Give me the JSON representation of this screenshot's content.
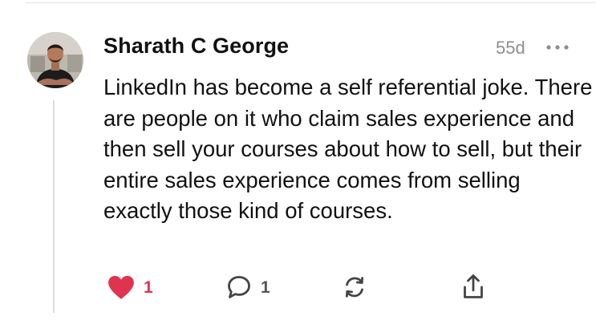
{
  "comment": {
    "author": "Sharath C George",
    "timestamp": "55d",
    "text": "LinkedIn has become a self referential joke. There are people on it who claim sales experience and then sell your courses about how to sell, but their entire sales experience comes from selling exactly those kind of courses.",
    "likes": "1",
    "replies": "1",
    "liked": true
  },
  "colors": {
    "like_active": "#e0334f",
    "muted": "#8e8e8e",
    "text": "#111111",
    "icon": "#444444"
  },
  "icons": {
    "more": "more-horizontal-icon",
    "like": "heart-icon",
    "reply": "speech-bubble-icon",
    "restack": "repost-icon",
    "share": "share-icon"
  }
}
